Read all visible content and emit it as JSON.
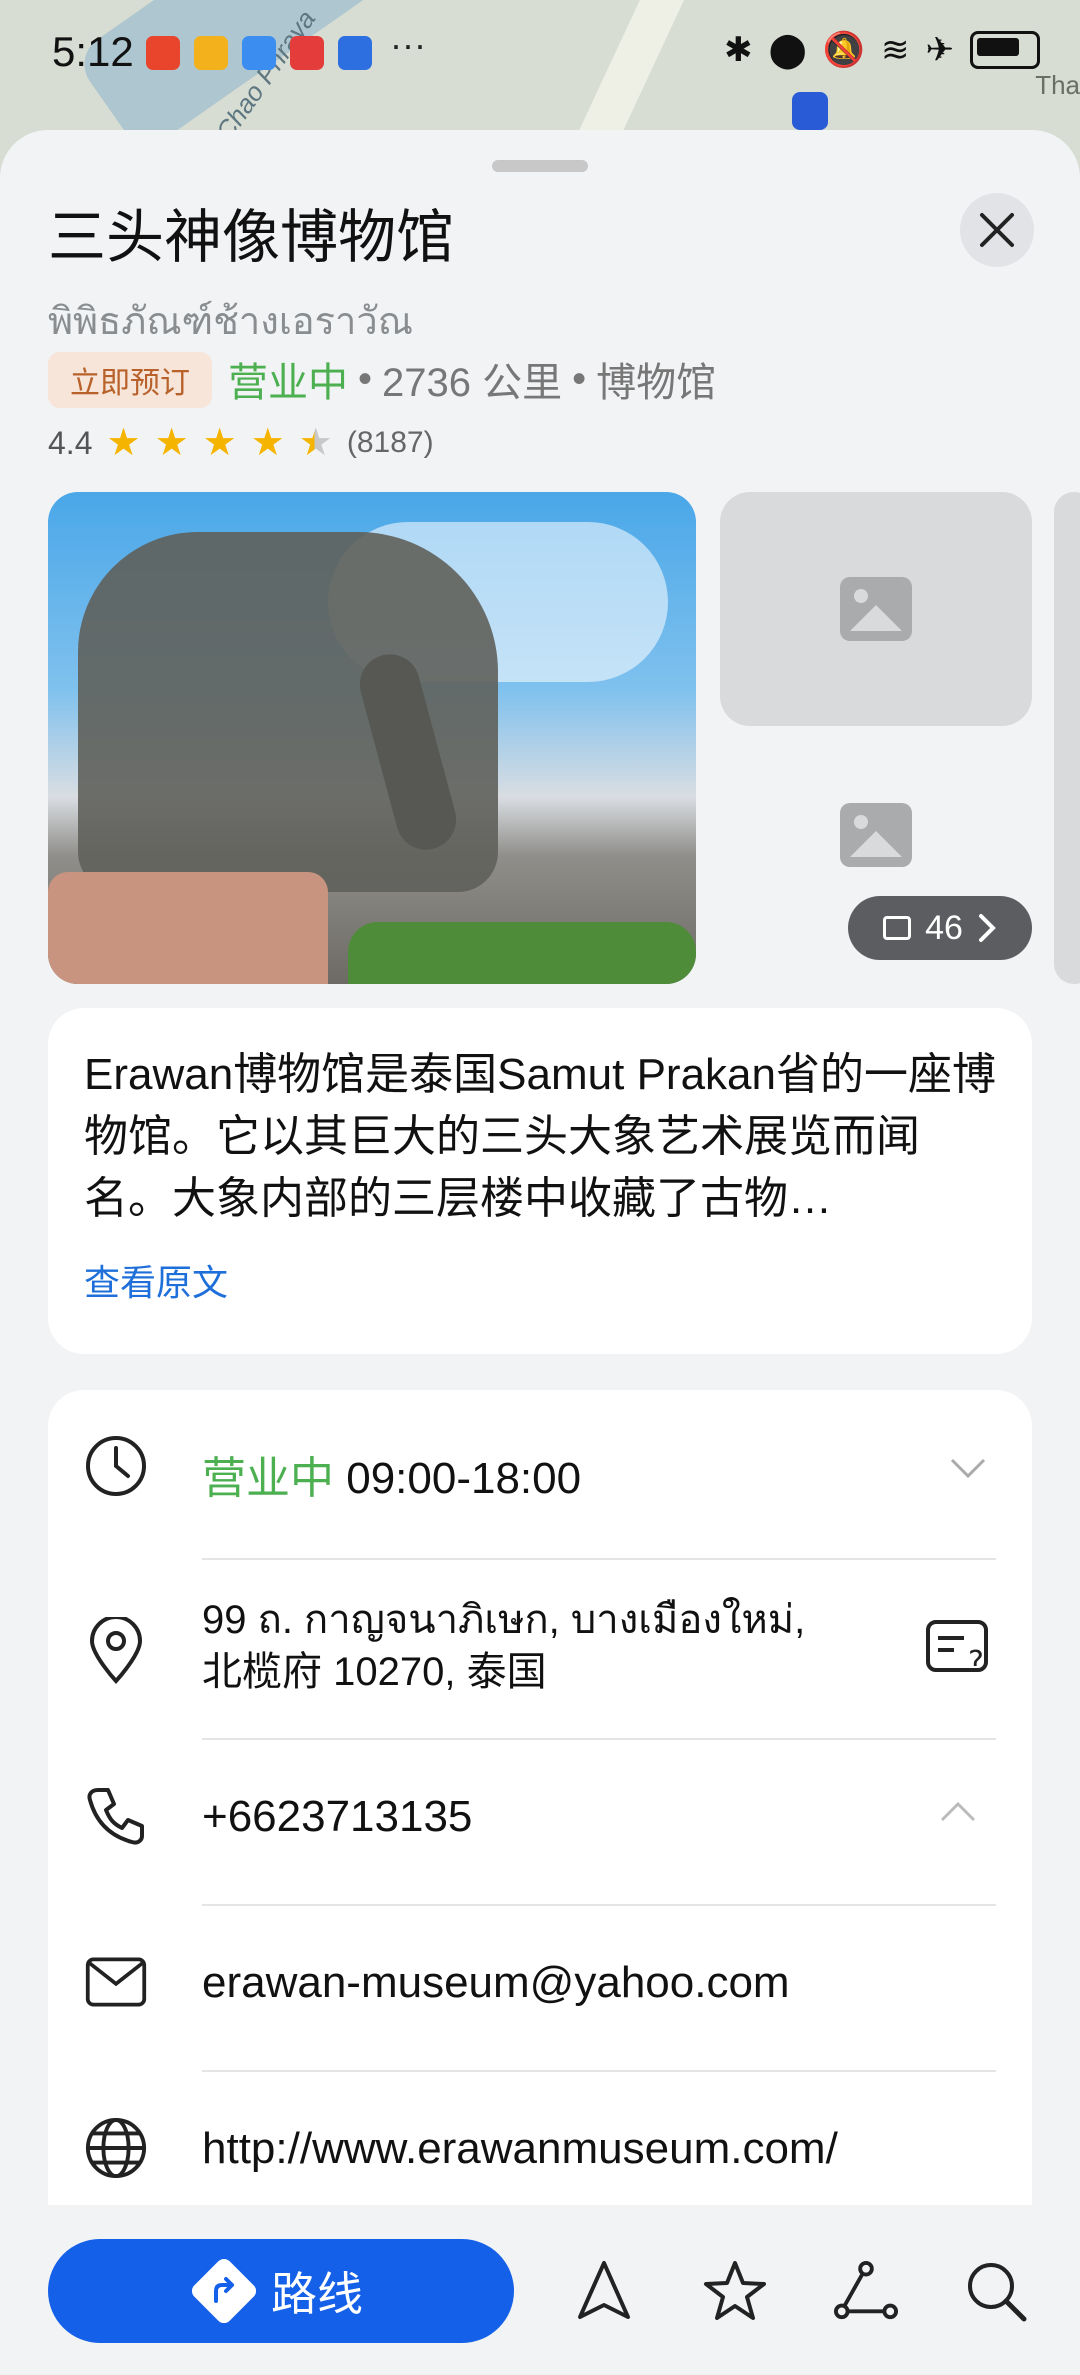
{
  "status_bar": {
    "time": "5:12",
    "more": "···"
  },
  "map": {
    "river_label": "Chao Phraya",
    "right_label": "Tha"
  },
  "place": {
    "title": "三头神像博物馆",
    "subtitle": "พิพิธภัณฑ์ช้างเอราวัณ",
    "book_label": "立即预订",
    "status": "营业中",
    "separator": "•",
    "distance": "2736 公里",
    "category": "博物馆",
    "rating": "4.4",
    "rating_stars": 4.4,
    "review_count": "(8187)"
  },
  "photos": {
    "count": "46"
  },
  "description": {
    "text": "Erawan博物馆是泰国Samut Prakan省的一座博物馆。它以其巨大的三头大象艺术展览而闻名。大象内部的三层楼中收藏了古物…",
    "link": "查看原文"
  },
  "info": {
    "hours_status": "营业中",
    "hours": "09:00-18:00",
    "address": "99 ถ. กาญจนาภิเษก, บางเมืองใหม่, 北榄府 10270, 泰国",
    "phone": "+6623713135",
    "email": "erawan-museum@yahoo.com",
    "website": "http://www.erawanmuseum.com/"
  },
  "bottom_bar": {
    "route_label": "路线"
  },
  "colors": {
    "accent_blue": "#1560e8",
    "open_green": "#4caf50",
    "link_blue": "#1e6fd9",
    "star_yellow": "#f5b400"
  }
}
